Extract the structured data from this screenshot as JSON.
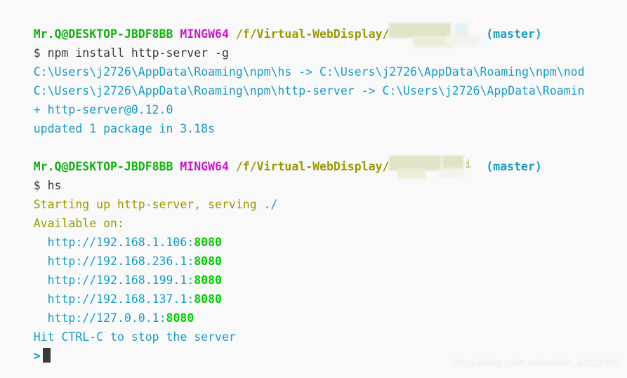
{
  "terminal": {
    "background_color": "#f9f9fa",
    "colors": {
      "user_host": "#14b014",
      "shell_name": "#c51cc5",
      "path": "#9a9a00",
      "branch": "#1a9cc0",
      "output_cyan": "#1a9cc0",
      "port": "#00cc00",
      "command_text": "#3a3a3a",
      "watermark": "#eceef0"
    },
    "blocks": [
      {
        "prompt": {
          "user_host": "Mr.Q@DESKTOP-JBDF8BB",
          "shell": "MINGW64",
          "path": "/f/Virtual-WebDisplay/",
          "path_redacted": true,
          "branch": "(master)"
        },
        "command_sigil": "$",
        "command": "npm install http-server -g",
        "output": [
          {
            "text": "C:\\Users\\j2726\\AppData\\Roaming\\npm\\hs -> C:\\Users\\j2726\\AppData\\Roaming\\npm\\nod",
            "color": "cyan",
            "truncated": true
          },
          {
            "text": "C:\\Users\\j2726\\AppData\\Roaming\\npm\\http-server -> C:\\Users\\j2726\\AppData\\Roamin",
            "color": "cyan",
            "truncated": true
          },
          {
            "text": "+ http-server@0.12.0",
            "color": "cyan",
            "truncated": false
          },
          {
            "text": "updated 1 package in 3.18s",
            "color": "cyan",
            "truncated": false
          }
        ]
      },
      {
        "prompt": {
          "user_host": "Mr.Q@DESKTOP-JBDF8BB",
          "shell": "MINGW64",
          "path": "/f/Virtual-WebDisplay/",
          "path_redacted": true,
          "branch": "(master)"
        },
        "command_sigil": "$",
        "command": "hs",
        "server": {
          "starting_text": "Starting up http-server, serving ",
          "serving_dir": "./",
          "available_label": "Available on:",
          "urls": [
            {
              "host": "http://192.168.1.106",
              "port": "8080"
            },
            {
              "host": "http://192.168.236.1",
              "port": "8080"
            },
            {
              "host": "http://192.168.199.1",
              "port": "8080"
            },
            {
              "host": "http://192.168.137.1",
              "port": "8080"
            },
            {
              "host": "http://127.0.0.1",
              "port": "8080"
            }
          ],
          "stop_hint": "Hit CTRL-C to stop the server"
        }
      }
    ],
    "final_prompt_sigil": ">",
    "cursor_visible": true,
    "watermark": "https://blog.csdn.net/weixin_43232955"
  }
}
